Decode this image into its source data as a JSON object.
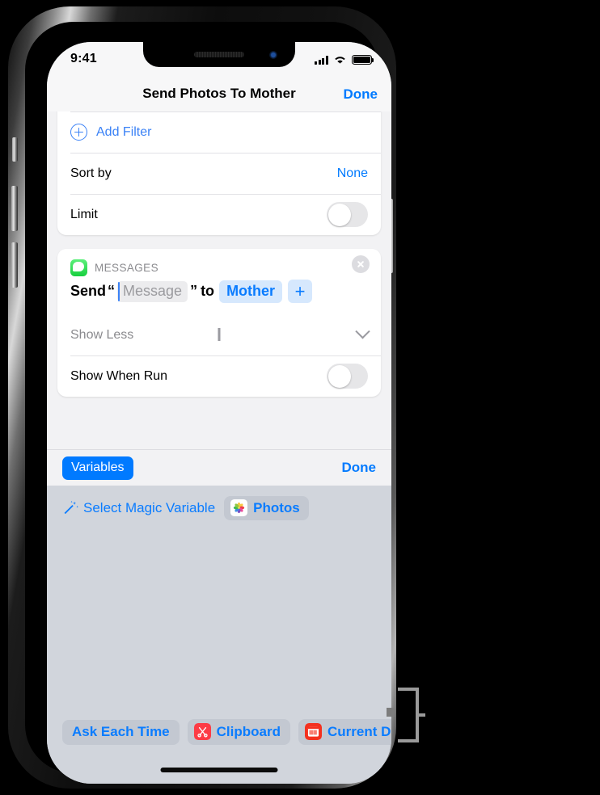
{
  "device": {
    "frame": "iphone-x",
    "side_buttons": [
      "silent-switch",
      "volume-up",
      "volume-down",
      "power"
    ]
  },
  "status_bar": {
    "time": "9:41",
    "icons": [
      "cellular-signal-icon",
      "wifi-icon",
      "battery-icon"
    ],
    "battery_full": true
  },
  "nav_bar": {
    "title": "Send Photos To Mother",
    "done_label": "Done"
  },
  "photos_card": {
    "rows": [
      {
        "type": "action",
        "icon": "plus-circle-icon",
        "label": "Add Filter"
      },
      {
        "type": "value",
        "label": "Sort by",
        "value": "None"
      },
      {
        "type": "toggle",
        "label": "Limit",
        "on": false
      }
    ]
  },
  "messages_card": {
    "app_icon": "messages-app-icon",
    "category": "MESSAGES",
    "close_icon": "close-circle-icon",
    "send_row": {
      "verb": "Send",
      "open_quote": "“",
      "message_placeholder": "Message",
      "close_quote": "”",
      "preposition": "to",
      "recipient_chip": "Mother",
      "add_recipient_label": "+"
    },
    "show_less_label": "Show Less",
    "show_less_icon": "chevron-down-icon",
    "show_when_run": {
      "label": "Show When Run",
      "on": false
    }
  },
  "variables_bar": {
    "pill_label": "Variables",
    "done_label": "Done"
  },
  "variable_panel": {
    "magic_variable": {
      "wand_icon": "magic-wand-icon",
      "label": "Select Magic Variable",
      "chip": {
        "icon": "photos-app-icon",
        "label": "Photos"
      }
    },
    "chips": [
      {
        "label": "Ask Each Time",
        "icon": null
      },
      {
        "label": "Clipboard",
        "icon": "scissors-icon",
        "icon_color": "#fc3b45"
      },
      {
        "label": "Current Date",
        "icon": "calendar-icon",
        "icon_color": "#f4311f"
      }
    ]
  },
  "colors": {
    "accent_blue": "#007aff",
    "link_blue": "#0a7cff",
    "chip_blue_bg": "#d6e8fd",
    "panel_gray": "#d1d5dc",
    "content_gray": "#f2f2f4",
    "card_white": "#ffffff",
    "secondary_text": "#8a8a8e"
  },
  "callout": {
    "type": "bracket-annotation",
    "points_to": "variable-chips-row"
  }
}
